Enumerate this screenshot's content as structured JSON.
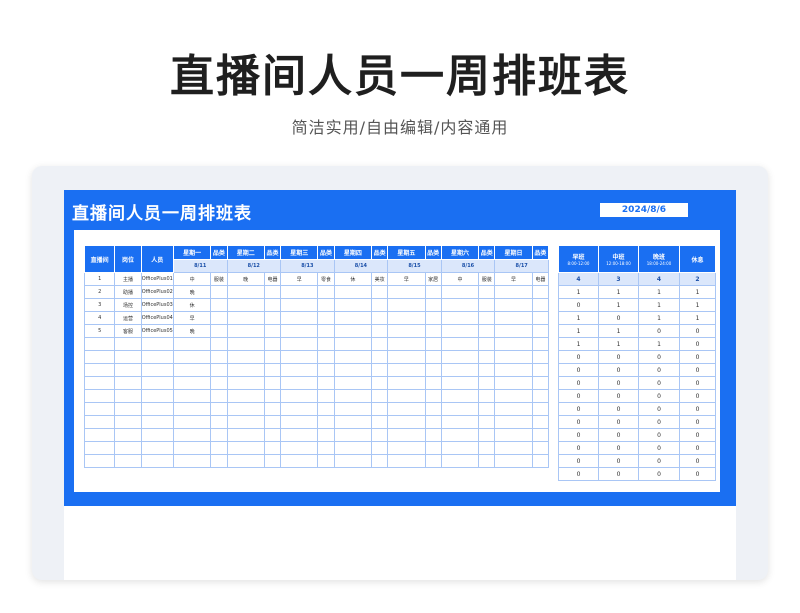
{
  "header": {
    "title": "直播间人员一周排班表",
    "subtitle": "简洁实用/自由编辑/内容通用"
  },
  "sheet": {
    "title": "直播间人员一周排班表",
    "date": "2024/8/6",
    "columns": {
      "room": "直播间",
      "position": "岗位",
      "staff": "人员",
      "category": "品类"
    },
    "days": [
      {
        "day": "星期一",
        "date": "8/11"
      },
      {
        "day": "星期二",
        "date": "8/12"
      },
      {
        "day": "星期三",
        "date": "8/13"
      },
      {
        "day": "星期四",
        "date": "8/14"
      },
      {
        "day": "星期五",
        "date": "8/15"
      },
      {
        "day": "星期六",
        "date": "8/16"
      },
      {
        "day": "星期日",
        "date": "8/17"
      }
    ],
    "rows": [
      {
        "no": "1",
        "position": "主播",
        "staff": "OfficePlus01",
        "cells": [
          "中",
          "服装",
          "晚",
          "电器",
          "早",
          "零食",
          "休",
          "美妆",
          "早",
          "家居",
          "中",
          "服装",
          "早",
          "电器"
        ]
      },
      {
        "no": "2",
        "position": "助播",
        "staff": "OfficePlus02",
        "cells": [
          "晚",
          "",
          "",
          "",
          "",
          "",
          "",
          "",
          "",
          "",
          "",
          "",
          "",
          ""
        ]
      },
      {
        "no": "3",
        "position": "场控",
        "staff": "OfficePlus03",
        "cells": [
          "休",
          "",
          "",
          "",
          "",
          "",
          "",
          "",
          "",
          "",
          "",
          "",
          "",
          ""
        ]
      },
      {
        "no": "4",
        "position": "运营",
        "staff": "OfficePlus04",
        "cells": [
          "早",
          "",
          "",
          "",
          "",
          "",
          "",
          "",
          "",
          "",
          "",
          "",
          "",
          ""
        ]
      },
      {
        "no": "5",
        "position": "客服",
        "staff": "OfficePlus05",
        "cells": [
          "晚",
          "",
          "",
          "",
          "",
          "",
          "",
          "",
          "",
          "",
          "",
          "",
          "",
          ""
        ]
      }
    ],
    "empty_rows": 10
  },
  "summary": {
    "headers": [
      {
        "label": "早班",
        "time": "8:00-12:00"
      },
      {
        "label": "中班",
        "time": "12:00-18:00"
      },
      {
        "label": "晚班",
        "time": "18:00-24:00"
      },
      {
        "label": "休息",
        "time": ""
      }
    ],
    "totals": [
      "4",
      "3",
      "4",
      "2"
    ],
    "rows": [
      [
        "1",
        "1",
        "1",
        "1"
      ],
      [
        "0",
        "1",
        "1",
        "1"
      ],
      [
        "1",
        "0",
        "1",
        "1"
      ],
      [
        "1",
        "1",
        "0",
        "0"
      ],
      [
        "1",
        "1",
        "1",
        "0"
      ],
      [
        "0",
        "0",
        "0",
        "0"
      ],
      [
        "0",
        "0",
        "0",
        "0"
      ],
      [
        "0",
        "0",
        "0",
        "0"
      ],
      [
        "0",
        "0",
        "0",
        "0"
      ],
      [
        "0",
        "0",
        "0",
        "0"
      ],
      [
        "0",
        "0",
        "0",
        "0"
      ],
      [
        "0",
        "0",
        "0",
        "0"
      ],
      [
        "0",
        "0",
        "0",
        "0"
      ],
      [
        "0",
        "0",
        "0",
        "0"
      ],
      [
        "0",
        "0",
        "0",
        "0"
      ]
    ]
  },
  "colors": {
    "accent": "#1a6ff2",
    "grid": "#a9c6f5",
    "date_row": "#dbe7fb"
  }
}
